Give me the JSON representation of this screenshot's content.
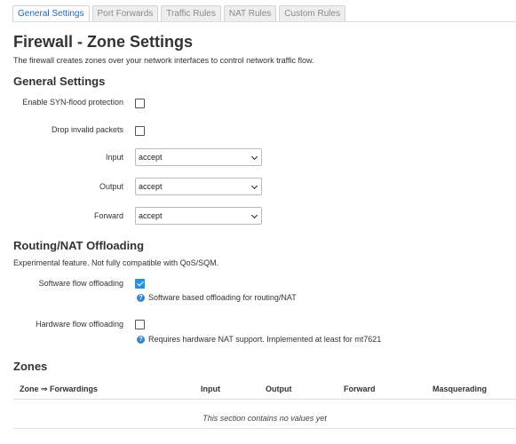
{
  "tabs": [
    "General Settings",
    "Port Forwards",
    "Traffic Rules",
    "NAT Rules",
    "Custom Rules"
  ],
  "page": {
    "title": "Firewall - Zone Settings",
    "description": "The firewall creates zones over your network interfaces to control network traffic flow."
  },
  "general": {
    "heading": "General Settings",
    "syn_flood_label": "Enable SYN-flood protection",
    "syn_flood_checked": false,
    "drop_invalid_label": "Drop invalid packets",
    "drop_invalid_checked": false,
    "input_label": "Input",
    "input_value": "accept",
    "output_label": "Output",
    "output_value": "accept",
    "forward_label": "Forward",
    "forward_value": "accept"
  },
  "offload": {
    "heading": "Routing/NAT Offloading",
    "description": "Experimental feature. Not fully compatible with QoS/SQM.",
    "software_label": "Software flow offloading",
    "software_checked": true,
    "software_hint": "Software based offloading for routing/NAT",
    "hardware_label": "Hardware flow offloading",
    "hardware_checked": false,
    "hardware_hint": "Requires hardware NAT support. Implemented at least for mt7621"
  },
  "zones": {
    "heading": "Zones",
    "columns": [
      "Zone ⇒ Forwardings",
      "Input",
      "Output",
      "Forward",
      "Masquerading"
    ],
    "empty_text": "This section contains no values yet"
  },
  "icons": {
    "info": "info-icon",
    "dropdown": "chevron-down-icon"
  },
  "colors": {
    "accent": "#2a64b1",
    "checkbox_checked": "#2c8fd8"
  }
}
